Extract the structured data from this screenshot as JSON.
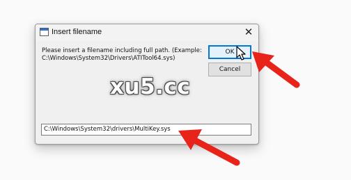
{
  "dialog": {
    "title": "Insert filename",
    "close_glyph": "✕",
    "message_line1": "Please insert a filename including full path. (Example:",
    "message_line2": "C:\\Windows\\System32\\Drivers\\ATITool64.sys)",
    "ok_label": "OK",
    "cancel_label": "Cancel",
    "path_value": "C:\\Windows\\System32\\drivers\\MultiKey.sys"
  },
  "watermark": "xu5.cc",
  "colors": {
    "annotation_arrow": "#e8231a",
    "default_button_border": "#0078d7"
  },
  "icons": {
    "app": "window-app-icon",
    "close": "close-icon",
    "cursor": "mouse-pointer-icon",
    "annotation": "red-arrow-icon"
  }
}
